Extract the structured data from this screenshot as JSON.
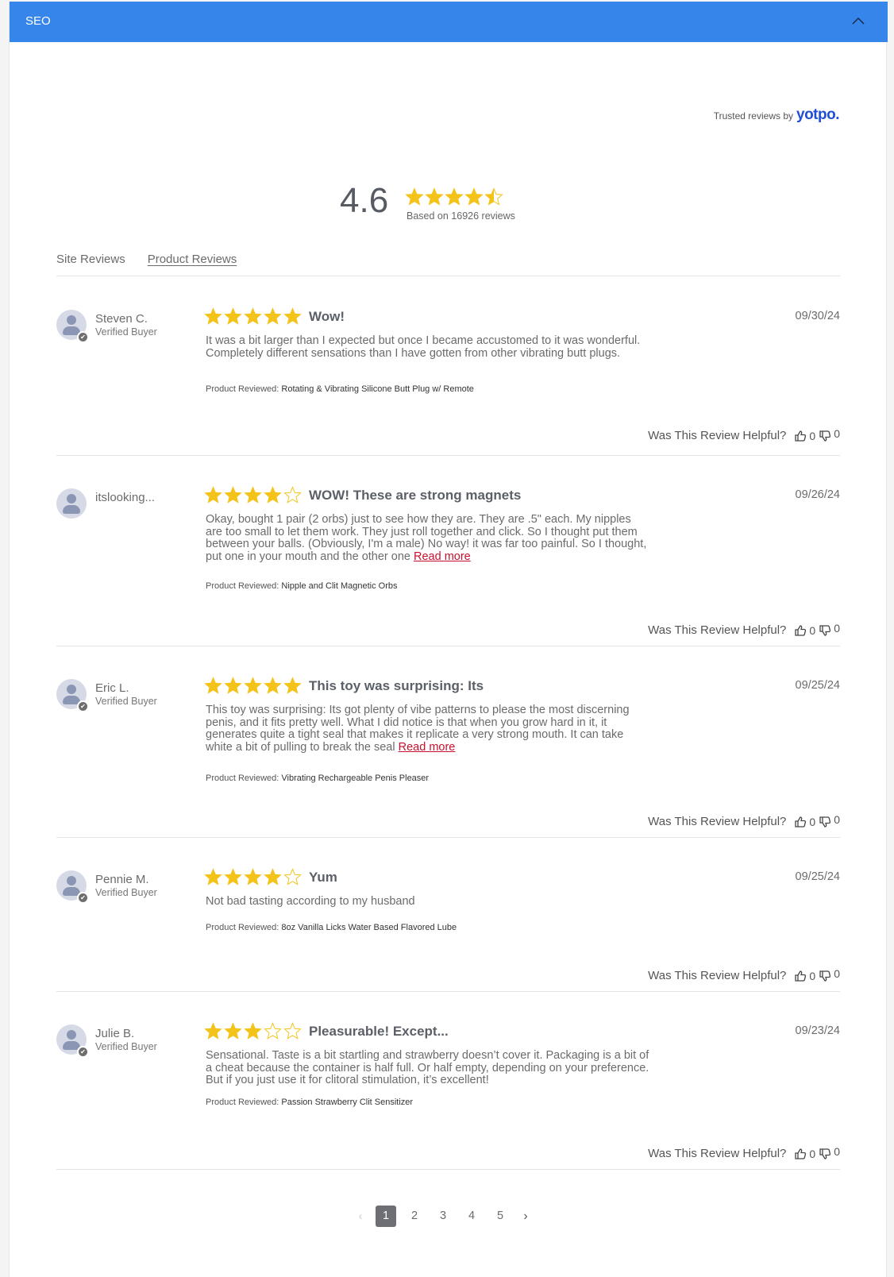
{
  "header": {
    "title": "SEO",
    "collapse_icon": "chevron-up-icon",
    "color": "#3685ea"
  },
  "trusted": {
    "prefix": "Trusted reviews by",
    "brand": "yotpo."
  },
  "summary": {
    "average": "4.6",
    "rating": 4.5,
    "based_on": "Based on 16926 reviews"
  },
  "tabs": [
    {
      "label": "Site Reviews",
      "active": false
    },
    {
      "label": "Product Reviews",
      "active": true
    }
  ],
  "star_color": "#f4c31a",
  "helpful_label": "Was This Review Helpful?",
  "product_reviewed_label": "Product Reviewed:",
  "read_more_label": "Read more",
  "reviews": [
    {
      "name": "Steven C.",
      "verified": "Verified Buyer",
      "rating": 5,
      "title": "Wow!",
      "date": "09/30/24",
      "body": "It was a bit larger than I expected but once I became accustomed to it was wonderful. Completely different sensations than I have gotten from other vibrating butt plugs.",
      "read_more": false,
      "product": "Rotating & Vibrating Silicone Butt Plug w/ Remote",
      "up": "0",
      "down": "0"
    },
    {
      "name": "itslooking...",
      "verified": "",
      "rating": 4,
      "title": "WOW! These are strong magnets",
      "date": "09/26/24",
      "body": "Okay, bought 1 pair (2 orbs) just to see how they are. They are .5\" each. My nipples are too small to let them work. They just roll together and click. So I thought put them between your balls. (Obviously, I'm a male) No way! it was far too painful. So I thought, put one in your mouth and the other one",
      "read_more": true,
      "product": "Nipple and Clit Magnetic Orbs",
      "up": "0",
      "down": "0"
    },
    {
      "name": "Eric L.",
      "verified": "Verified Buyer",
      "rating": 5,
      "title": "This toy was surprising: Its",
      "date": "09/25/24",
      "body": "This toy was surprising: Its got plenty of vibe patterns to please the most discerning penis, and it fits pretty well. What I did notice is that when you grow hard in it, it generates quite a tight seal that makes it replicate a very strong mouth. It can take white a bit of pulling to break the seal",
      "read_more": true,
      "product": "Vibrating Rechargeable Penis Pleaser",
      "up": "0",
      "down": "0"
    },
    {
      "name": "Pennie M.",
      "verified": "Verified Buyer",
      "rating": 4,
      "title": "Yum",
      "date": "09/25/24",
      "body": "Not bad tasting according to my husband",
      "read_more": false,
      "product": "8oz Vanilla Licks Water Based Flavored Lube",
      "up": "0",
      "down": "0"
    },
    {
      "name": "Julie B.",
      "verified": "Verified Buyer",
      "rating": 3,
      "title": "Pleasurable! Except...",
      "date": "09/23/24",
      "body": "Sensational. Taste is a bit startling and strawberry doesn’t cover it. Packaging is a bit of a cheat because the container is half full. Or half empty, depending on your preference. But if you just use it for clitoral stimulation, it’s excellent!",
      "read_more": false,
      "product": "Passion Strawberry Clit Sensitizer",
      "up": "0",
      "down": "0"
    }
  ],
  "pagination": {
    "pages": [
      "1",
      "2",
      "3",
      "4",
      "5"
    ],
    "current": "1",
    "prev_icon": "chevron-left-icon",
    "next_icon": "chevron-right-icon"
  }
}
